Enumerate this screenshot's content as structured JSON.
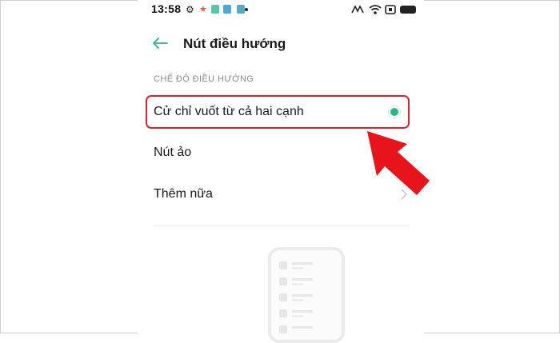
{
  "status_bar": {
    "time": "13:58",
    "left_icons": [
      "gear-icon",
      "star-icon",
      "app-icon",
      "app-icon",
      "app-icon",
      "notification-dot"
    ],
    "right_icons": [
      "nfc-icon",
      "wifi-icon",
      "battery-saver-icon",
      "battery-icon"
    ]
  },
  "header": {
    "title": "Nút điều hướng",
    "back_icon": "arrow-left-icon"
  },
  "section": {
    "label": "CHẾ ĐỘ ĐIỀU HƯỚNG"
  },
  "options": [
    {
      "label": "Cử chỉ vuốt từ cả hai cạnh",
      "selected": true
    },
    {
      "label": "Nút ảo",
      "selected": false
    },
    {
      "label": "Thêm nữa",
      "selected": false
    }
  ],
  "colors": {
    "accent": "#2fb482",
    "highlight": "#d7262e",
    "back_arrow": "#2fb482"
  }
}
